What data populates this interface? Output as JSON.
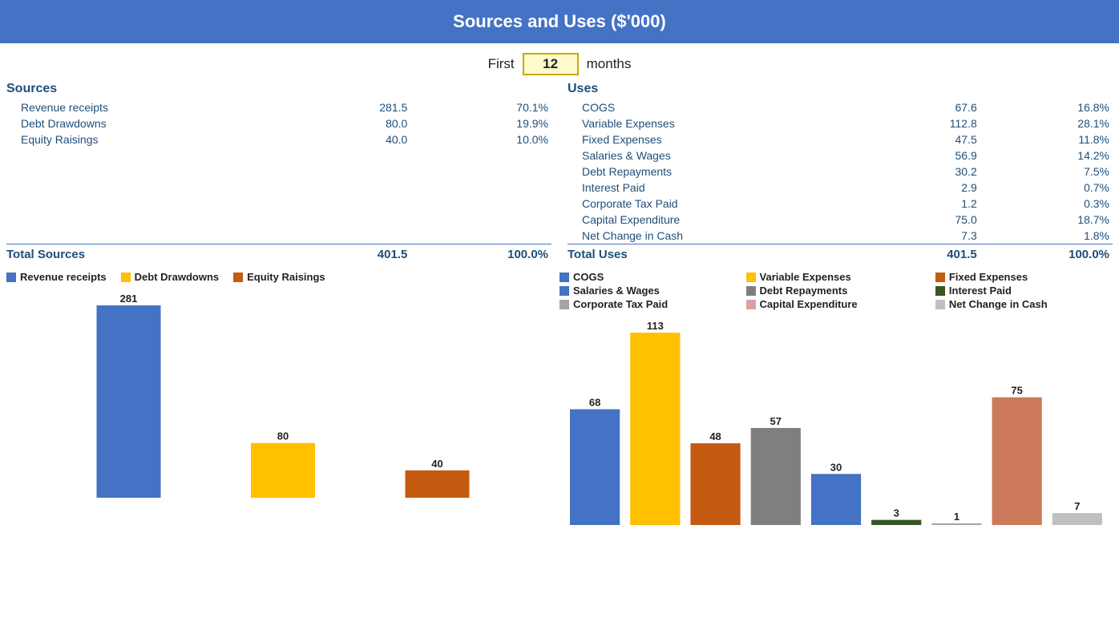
{
  "header": {
    "title": "Sources and Uses ($'000)"
  },
  "months": {
    "label_first": "First",
    "value": "12",
    "label_after": "months"
  },
  "sources": {
    "title": "Sources",
    "items": [
      {
        "label": "Revenue receipts",
        "value": "281.5",
        "pct": "70.1%"
      },
      {
        "label": "Debt Drawdowns",
        "value": "80.0",
        "pct": "19.9%"
      },
      {
        "label": "Equity Raisings",
        "value": "40.0",
        "pct": "10.0%"
      }
    ],
    "total": {
      "label": "Total Sources",
      "value": "401.5",
      "pct": "100.0%"
    }
  },
  "uses": {
    "title": "Uses",
    "items": [
      {
        "label": "COGS",
        "value": "67.6",
        "pct": "16.8%"
      },
      {
        "label": "Variable Expenses",
        "value": "112.8",
        "pct": "28.1%"
      },
      {
        "label": "Fixed Expenses",
        "value": "47.5",
        "pct": "11.8%"
      },
      {
        "label": "Salaries & Wages",
        "value": "56.9",
        "pct": "14.2%"
      },
      {
        "label": "Debt Repayments",
        "value": "30.2",
        "pct": "7.5%"
      },
      {
        "label": "Interest Paid",
        "value": "2.9",
        "pct": "0.7%"
      },
      {
        "label": "Corporate Tax Paid",
        "value": "1.2",
        "pct": "0.3%"
      },
      {
        "label": "Capital Expenditure",
        "value": "75.0",
        "pct": "18.7%"
      },
      {
        "label": "Net Change in Cash",
        "value": "7.3",
        "pct": "1.8%"
      }
    ],
    "total": {
      "label": "Total Uses",
      "value": "401.5",
      "pct": "100.0%"
    }
  },
  "left_chart": {
    "legend": [
      {
        "label": "Revenue receipts",
        "color": "#4472C4"
      },
      {
        "label": "Debt Drawdowns",
        "color": "#FFC000"
      },
      {
        "label": "Equity Raisings",
        "color": "#C55A11"
      }
    ],
    "bars": [
      {
        "label": "Revenue receipts",
        "value": 281,
        "color": "#4472C4"
      },
      {
        "label": "Debt Drawdowns",
        "value": 80,
        "color": "#FFC000"
      },
      {
        "label": "Equity Raisings",
        "value": 40,
        "color": "#C55A11"
      }
    ]
  },
  "right_chart": {
    "legend": [
      {
        "label": "COGS",
        "color": "#4472C4"
      },
      {
        "label": "Variable Expenses",
        "color": "#FFC000"
      },
      {
        "label": "Fixed Expenses",
        "color": "#C55A11"
      },
      {
        "label": "Salaries & Wages",
        "color": "#4472C4"
      },
      {
        "label": "Debt Repayments",
        "color": "#7F7F7F"
      },
      {
        "label": "Interest Paid",
        "color": "#375623"
      },
      {
        "label": "Corporate Tax Paid",
        "color": "#A5A5A5"
      },
      {
        "label": "Capital Expenditure",
        "color": "#D9A0A0"
      },
      {
        "label": "Net Change in Cash",
        "color": "#C0C0C0"
      }
    ],
    "bars": [
      {
        "label": "COGS",
        "value": 68,
        "color": "#4472C4"
      },
      {
        "label": "Variable Expenses",
        "value": 113,
        "color": "#FFC000"
      },
      {
        "label": "Fixed Expenses",
        "value": 48,
        "color": "#C55A11"
      },
      {
        "label": "Salaries & Wages",
        "value": 57,
        "color": "#7F7F7F"
      },
      {
        "label": "Debt Repayments",
        "value": 30,
        "color": "#4472C4"
      },
      {
        "label": "Interest Paid",
        "value": 3,
        "color": "#375623"
      },
      {
        "label": "Corporate Tax Paid",
        "value": 1,
        "color": "#A5A5A5"
      },
      {
        "label": "Capital Expenditure",
        "value": 75,
        "color": "#CC7A5A"
      },
      {
        "label": "Net Change in Cash",
        "value": 7,
        "color": "#C0C0C0"
      }
    ]
  }
}
